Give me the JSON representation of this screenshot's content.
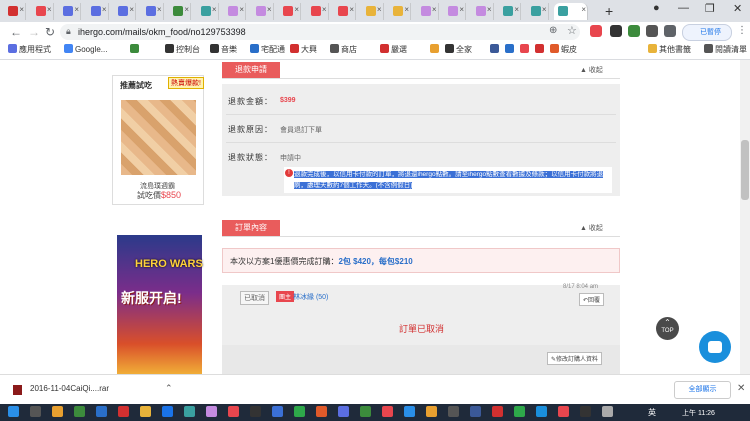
{
  "browser": {
    "address_url": "ihergo.com/mails/okm_food/no129753398",
    "new_tab": "+",
    "profile_label": "已暫停",
    "bookmarks": [
      {
        "label": "應用程式",
        "color": "#5b6ee1"
      },
      {
        "label": "Google...",
        "color": "#4285f4"
      },
      {
        "label": "",
        "color": "#3c8b3c"
      },
      {
        "label": "控制台",
        "color": "#333333"
      },
      {
        "label": "音樂",
        "color": "#333333"
      },
      {
        "label": "宅配通",
        "color": "#2a6fc9"
      },
      {
        "label": "大興",
        "color": "#d23030"
      },
      {
        "label": "商店",
        "color": "#555555"
      },
      {
        "label": "嚴選",
        "color": "#d23030"
      },
      {
        "label": "",
        "color": "#e8a030"
      },
      {
        "label": "全家",
        "color": "#333333"
      },
      {
        "label": "",
        "color": "#3b5998"
      },
      {
        "label": "",
        "color": "#2a6fc9"
      },
      {
        "label": "",
        "color": "#e8464e"
      },
      {
        "label": "",
        "color": "#d23030"
      },
      {
        "label": "蝦皮",
        "color": "#e05a2a"
      },
      {
        "label": "其他書籤",
        "color": "#e8b33a"
      },
      {
        "label": "閱讀清單",
        "color": "#555555"
      }
    ]
  },
  "sidebar": {
    "title": "推薦試吃",
    "badge": "熱賣爆款!",
    "product_name": "流島璞週霸",
    "price_label": "試吃價",
    "price": "$850",
    "ad_logo": "HERO WARS",
    "ad_text": "新服开启!"
  },
  "order": {
    "section_title": "退款申請",
    "collapse_label": "▲ 收起",
    "amount_label": "退款金額：",
    "amount": "$399",
    "reason_label": "退款原因：",
    "reason": "會員退訂下單",
    "status_label": "退款狀態：",
    "status": "申請中",
    "highlight": "退款完成後，以信用卡付款的訂單，將退還ihergo點數。請至ihergo點數查看數據及條款；以信用卡付款將退刷，處理天數約7個工作天。(不含例假日)"
  },
  "content": {
    "section_title": "訂單內容",
    "collapse_label": "▲ 收起",
    "notice_prefix": "本次以方案1優惠價完成訂購：",
    "notice_value": "2包 $420，每包$210",
    "cancel_tag": "已取消",
    "leader_tag": "團主",
    "leader_name": "林冰緣 (50)",
    "msg_time": "8/17 8:04 am",
    "reply_label": "回覆",
    "cancelled_text": "訂單已取消",
    "edit_label": "修改訂購人資料",
    "top_button": "TOP"
  },
  "downloads": {
    "file_name": "2016-11-04CaiQi....rar",
    "show_all": "全部顯示"
  },
  "taskbar": {
    "lang": "英",
    "time": "上午 11:26"
  }
}
